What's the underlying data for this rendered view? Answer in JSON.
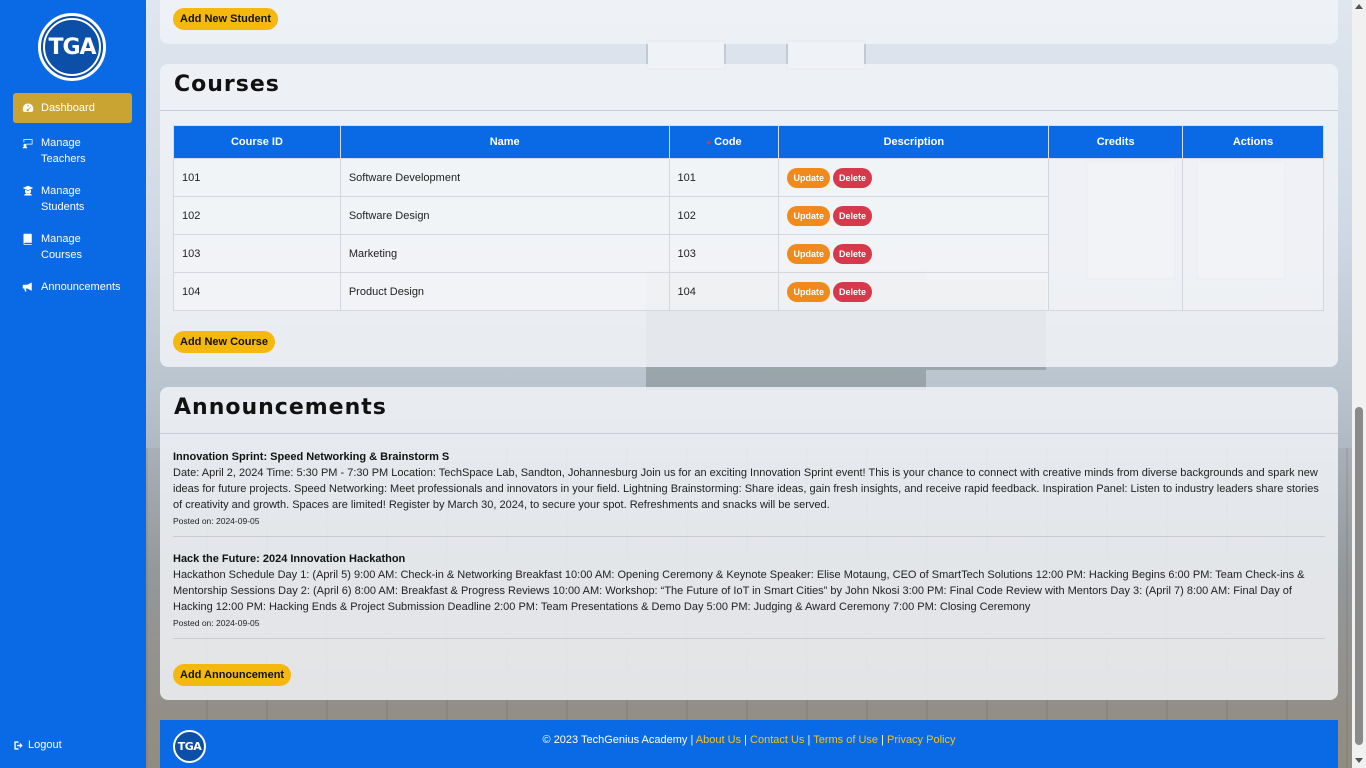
{
  "brand": {
    "logo_text": "TGA"
  },
  "sidebar": {
    "items": [
      {
        "label": "Dashboard",
        "icon": "dashboard-icon",
        "active": true
      },
      {
        "label": "Manage Teachers",
        "icon": "teacher-icon",
        "active": false
      },
      {
        "label": "Manage Students",
        "icon": "student-icon",
        "active": false
      },
      {
        "label": "Manage Courses",
        "icon": "book-icon",
        "active": false
      },
      {
        "label": "Announcements",
        "icon": "megaphone-icon",
        "active": false
      }
    ],
    "logout": "Logout"
  },
  "students": {
    "add_button": "Add New Student"
  },
  "courses": {
    "title": "Courses",
    "columns": [
      "Course ID",
      "Name",
      "Code",
      "Description",
      "Credits",
      "Actions"
    ],
    "rows": [
      {
        "id": "101",
        "name": "Software Development",
        "code": "101"
      },
      {
        "id": "102",
        "name": "Software Design",
        "code": "102"
      },
      {
        "id": "103",
        "name": "Marketing",
        "code": "103"
      },
      {
        "id": "104",
        "name": "Product Design",
        "code": "104"
      }
    ],
    "update_label": "Update",
    "delete_label": "Delete",
    "add_button": "Add New Course"
  },
  "announcements": {
    "title": "Announcements",
    "items": [
      {
        "title": "Innovation Sprint: Speed Networking & Brainstorm S",
        "body": "Date: April 2, 2024 Time: 5:30 PM - 7:30 PM Location: TechSpace Lab, Sandton, Johannesburg Join us for an exciting Innovation Sprint event! This is your chance to connect with creative minds from diverse backgrounds and spark new ideas for future projects. Speed Networking: Meet professionals and innovators in your field. Lightning Brainstorming: Share ideas, gain fresh insights, and receive rapid feedback. Inspiration Panel: Listen to industry leaders share stories of creativity and growth. Spaces are limited! Register by March 30, 2024, to secure your spot. Refreshments and snacks will be served.",
        "posted": "Posted on: 2024-09-05"
      },
      {
        "title": "Hack the Future: 2024 Innovation Hackathon",
        "body": "Hackathon Schedule Day 1: (April 5) 9:00 AM: Check-in & Networking Breakfast 10:00 AM: Opening Ceremony & Keynote Speaker: Elise Motaung, CEO of SmartTech Solutions 12:00 PM: Hacking Begins 6:00 PM: Team Check-ins & Mentorship Sessions Day 2: (April 6) 8:00 AM: Breakfast & Progress Reviews 10:00 AM: Workshop: “The Future of IoT in Smart Cities” by John Nkosi 3:00 PM: Final Code Review with Mentors Day 3: (April 7) 8:00 AM: Final Day of Hacking 12:00 PM: Hacking Ends & Project Submission Deadline 2:00 PM: Team Presentations & Demo Day 5:00 PM: Judging & Award Ceremony 7:00 PM: Closing Ceremony",
        "posted": "Posted on: 2024-09-05"
      }
    ],
    "add_button": "Add Announcement"
  },
  "footer": {
    "logo_text": "TGA",
    "copyright": "© 2023 TechGenius Academy |",
    "links": [
      "About Us",
      "Contact Us",
      "Terms of Use",
      "Privacy Policy"
    ],
    "separator": "|"
  },
  "colors": {
    "primary": "#0a6ae6",
    "accent": "#f5b80f",
    "active_nav": "#c9a432",
    "update": "#f08a1c",
    "delete": "#d6394b"
  }
}
